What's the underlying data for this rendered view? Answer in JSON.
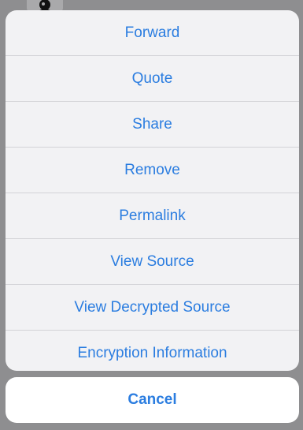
{
  "avatar": {
    "icon": "person-silhouette-icon"
  },
  "action_sheet": {
    "items": [
      {
        "label": "Forward"
      },
      {
        "label": "Quote"
      },
      {
        "label": "Share"
      },
      {
        "label": "Remove"
      },
      {
        "label": "Permalink"
      },
      {
        "label": "View Source"
      },
      {
        "label": "View Decrypted Source"
      },
      {
        "label": "Encryption Information"
      }
    ],
    "cancel_label": "Cancel"
  },
  "colors": {
    "accent": "#2b7de0",
    "sheet_background": "#f2f2f4",
    "separator": "#d3d3d7",
    "dimmed_backdrop": "#8e8e90"
  }
}
